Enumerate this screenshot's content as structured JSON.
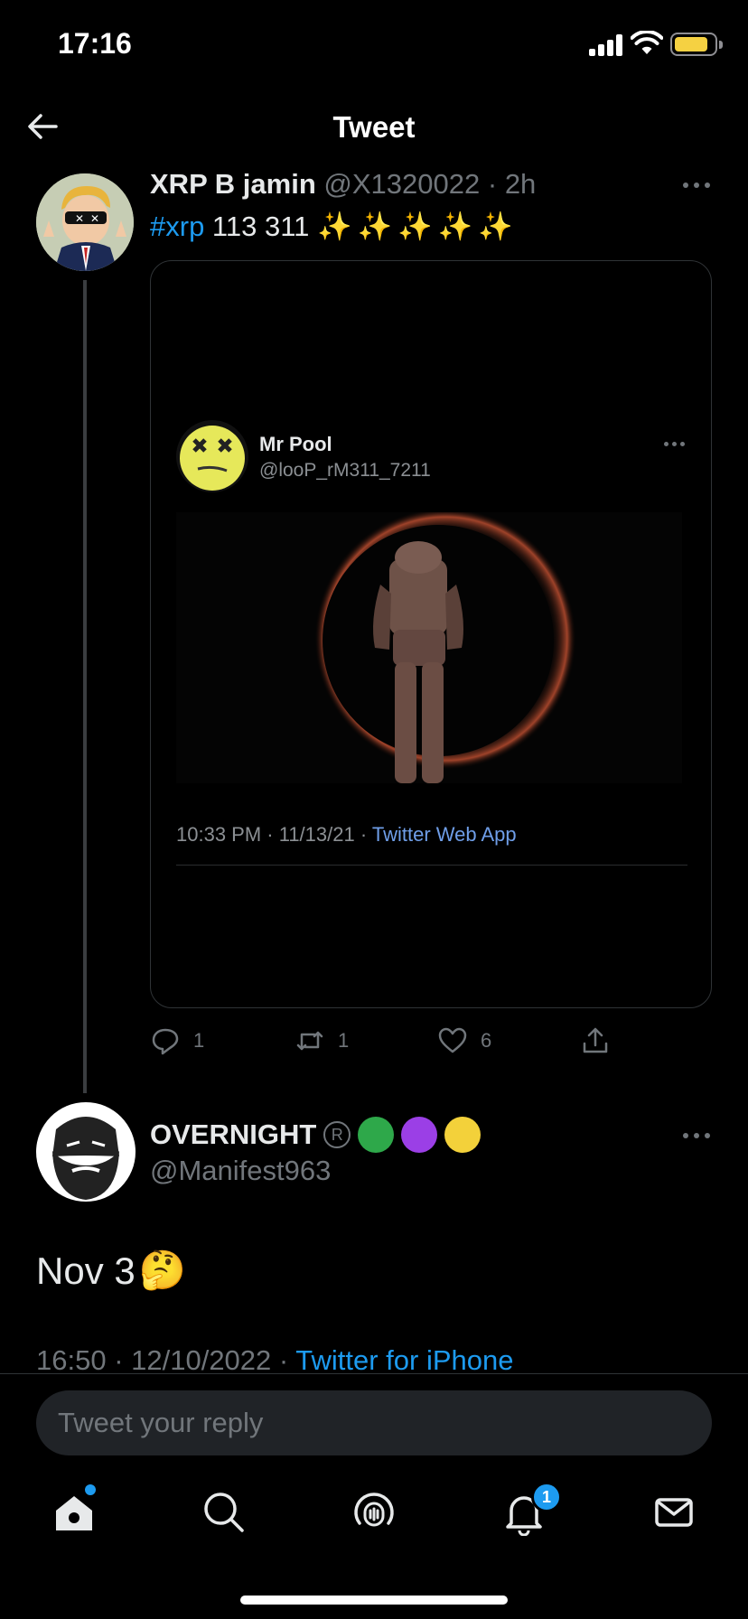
{
  "status_bar": {
    "time": "17:16",
    "battery_level": 0.85,
    "battery_color": "#f5d142"
  },
  "header": {
    "title": "Tweet",
    "back_icon": "arrow-left-icon"
  },
  "tweet1": {
    "display_name": "XRP B jamin",
    "handle": "@X1320022",
    "separator": "·",
    "time_ago": "2h",
    "hashtag": "#xrp",
    "text": " 113 311 ",
    "sparkles": "✨✨✨✨✨",
    "embedded": {
      "name": "Mr Pool",
      "handle": "@looP_rM311_7211",
      "timestamp": "10:33 PM · 11/13/21 · ",
      "source": "Twitter Web App"
    },
    "actions": {
      "reply_count": "1",
      "retweet_count": "1",
      "like_count": "6"
    }
  },
  "tweet2": {
    "display_name": "OVERNIGHT",
    "registered_mark": "R",
    "status_circles": [
      "#2ea84a",
      "#9b3fe6",
      "#f3d13a"
    ],
    "handle": "@Manifest963",
    "body": "Nov 3",
    "body_emoji": "🤔",
    "timestamp": "16:50 · 12/10/2022 · ",
    "source": "Twitter for iPhone"
  },
  "reply": {
    "placeholder": "Tweet your reply"
  },
  "tab_bar": {
    "items": [
      "home-icon",
      "search-icon",
      "spaces-icon",
      "notifications-icon",
      "messages-icon"
    ],
    "notification_badge": "1"
  },
  "colors": {
    "accent": "#1d9bf0",
    "muted": "#71767b",
    "background": "#000000"
  }
}
